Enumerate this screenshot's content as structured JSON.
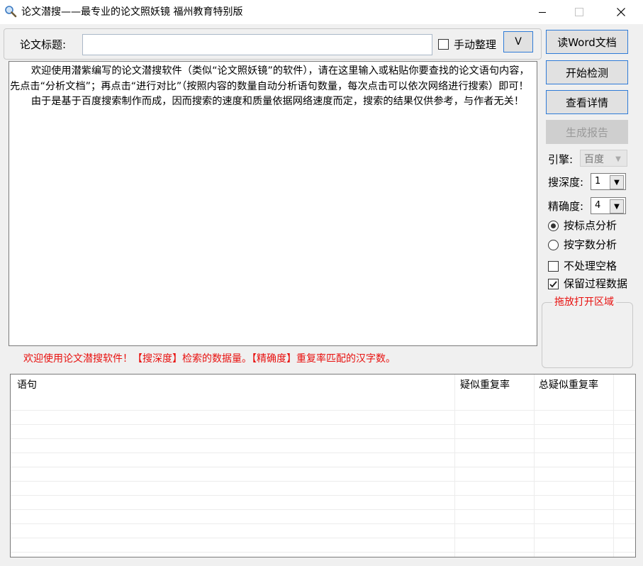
{
  "window": {
    "title": "论文潜搜——最专业的论文照妖镜 福州教育特别版",
    "icon": "magnifier-icon",
    "controls": [
      "minimize-icon",
      "maximize-icon",
      "close-icon"
    ]
  },
  "title_row": {
    "label": "论文标题:",
    "input_value": "",
    "manual_label": "手动整理",
    "manual_checked": false,
    "expand_label": "V"
  },
  "content": {
    "paragraphs": [
      "欢迎使用潜紫编写的论文潜搜软件（类似“论文照妖镜”的软件），请在这里输入或粘贴你要查找的论文语句内容，先点击“分析文档”；再点击“进行对比”（按照内容的数量自动分析语句数量，每次点击可以依次网络进行搜索）即可！",
      "由于是基于百度搜索制作而成，因而搜索的速度和质量依据网络速度而定，搜索的结果仅供参考，与作者无关！"
    ]
  },
  "status": {
    "text": "欢迎使用论文潜搜软件！【搜深度】检索的数据量。【精确度】重复率匹配的汉字数。",
    "color": "#e8110f"
  },
  "buttons": {
    "read_word": "读Word文档",
    "start_check": "开始检测",
    "view_details": "查看详情",
    "generate_report": "生成报告",
    "generate_report_enabled": false
  },
  "options": {
    "engine_label": "引擎:",
    "engine_value": "百度",
    "depth_label": "搜深度:",
    "depth_value": "1",
    "precision_label": "精确度:",
    "precision_value": "4",
    "radio_punct": "按标点分析",
    "radio_count": "按字数分析",
    "radio_selected": "punct",
    "no_space_label": "不处理空格",
    "no_space_checked": false,
    "keep_data_label": "保留过程数据",
    "keep_data_checked": true,
    "drop_zone_label": "拖放打开区域"
  },
  "table": {
    "headers": [
      "语句",
      "疑似重复率",
      "总疑似重复率"
    ],
    "rows": []
  },
  "colors": {
    "window_bg": "#f0f0f0",
    "accent_border": "#2f7bd7",
    "status_red": "#e8110f"
  }
}
